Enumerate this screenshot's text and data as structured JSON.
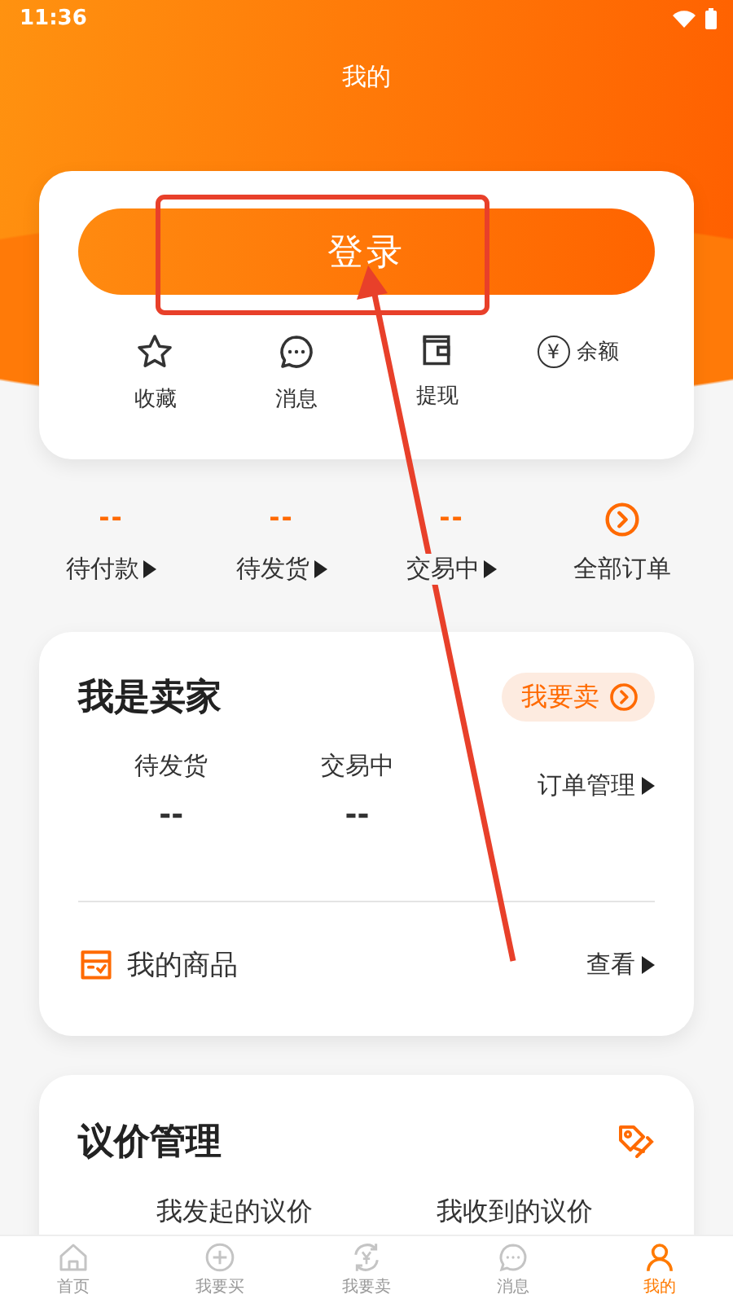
{
  "status_bar": {
    "time": "11:36"
  },
  "title": "我的",
  "account_card": {
    "login_button": "登录",
    "shortcuts": [
      {
        "label": "收藏",
        "kind": "star"
      },
      {
        "label": "消息",
        "kind": "chat"
      },
      {
        "label": "提现",
        "kind": "wallet"
      }
    ],
    "balance": {
      "symbol": "¥",
      "label": "余额"
    }
  },
  "orders": [
    {
      "kind": "count",
      "count": "--",
      "label": "待付款"
    },
    {
      "kind": "count",
      "count": "--",
      "label": "待发货"
    },
    {
      "kind": "count",
      "count": "--",
      "label": "交易中"
    },
    {
      "kind": "all",
      "label": "全部订单"
    }
  ],
  "seller": {
    "title": "我是卖家",
    "sell_button": "我要卖",
    "stats": [
      {
        "label": "待发货",
        "value": "--"
      },
      {
        "label": "交易中",
        "value": "--"
      }
    ],
    "manage_link": "订单管理",
    "products": {
      "label": "我的商品",
      "link": "查看"
    }
  },
  "negotiation": {
    "title": "议价管理",
    "items": [
      "我发起的议价",
      "我收到的议价"
    ]
  },
  "tab_bar": [
    {
      "label": "首页",
      "kind": "home",
      "selected": false
    },
    {
      "label": "我要买",
      "kind": "plus",
      "selected": false
    },
    {
      "label": "我要卖",
      "kind": "yen",
      "selected": false
    },
    {
      "label": "消息",
      "kind": "chat",
      "selected": false
    },
    {
      "label": "我的",
      "kind": "person",
      "selected": true
    }
  ]
}
